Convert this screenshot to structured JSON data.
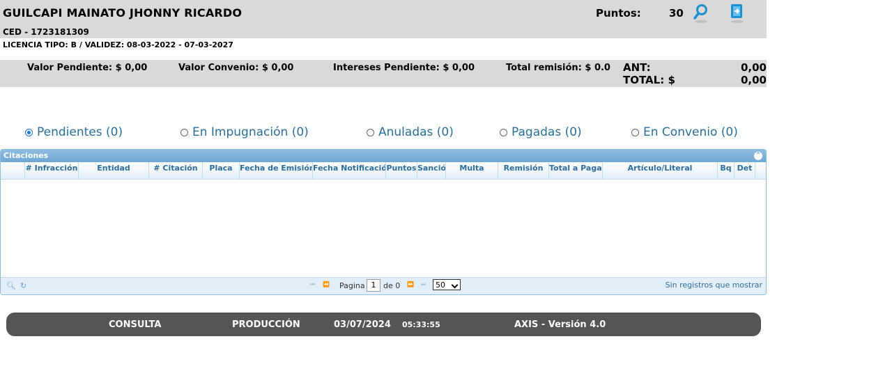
{
  "header": {
    "driver_name": "GUILCAPI MAINATO JHONNY RICARDO",
    "ced": "CED - 1723181309",
    "licencia": "LICENCIA TIPO: B   / VALIDEZ: 08-03-2022 - 07-03-2027",
    "puntos_label": "Puntos:",
    "puntos_value": "30",
    "search_icon": "search-icon",
    "exit_icon": "exit-icon"
  },
  "summary": {
    "valor_pendiente": "Valor Pendiente: $  0,00",
    "valor_convenio": "Valor Convenio: $  0,00",
    "intereses_pendiente": "Intereses Pendiente: $  0,00",
    "total_remision": "Total remisión: $ 0.0",
    "ant_label": "ANT:",
    "ant_value": "0,00",
    "total_label": "TOTAL: $",
    "total_value": "0,00"
  },
  "filters": [
    {
      "label": "Pendientes (0)",
      "checked": true
    },
    {
      "label": "En Impugnación (0)",
      "checked": false
    },
    {
      "label": "Anuladas (0)",
      "checked": false
    },
    {
      "label": "Pagadas (0)",
      "checked": false
    },
    {
      "label": "En Convenio (0)",
      "checked": false
    }
  ],
  "grid": {
    "title": "Citaciones",
    "columns": [
      "# Infracción",
      "Entidad",
      "# Citación",
      "Placa",
      "Fecha de Emisión",
      "Fecha Notificación",
      "Puntos",
      "Sanción",
      "Multa",
      "Remisión",
      "Total a Pagar",
      "Artículo/Literal",
      "Bq",
      "Det"
    ],
    "rows": [],
    "pager": {
      "page_label": "Pagina",
      "page_value": "1",
      "of_label": "de 0",
      "page_size": "50",
      "empty_message": "Sin registros que mostrar"
    }
  },
  "footer": {
    "consulta": "CONSULTA",
    "produccion": "PRODUCCIÓN",
    "date": "03/07/2024",
    "time": "05:33:55",
    "version": "AXIS - Versión 4.0"
  },
  "colors": {
    "header_bg": "#d9d9d9",
    "link_blue": "#2a6f9a",
    "grid_border": "#8fbfe0",
    "footer_bg": "#555555"
  }
}
